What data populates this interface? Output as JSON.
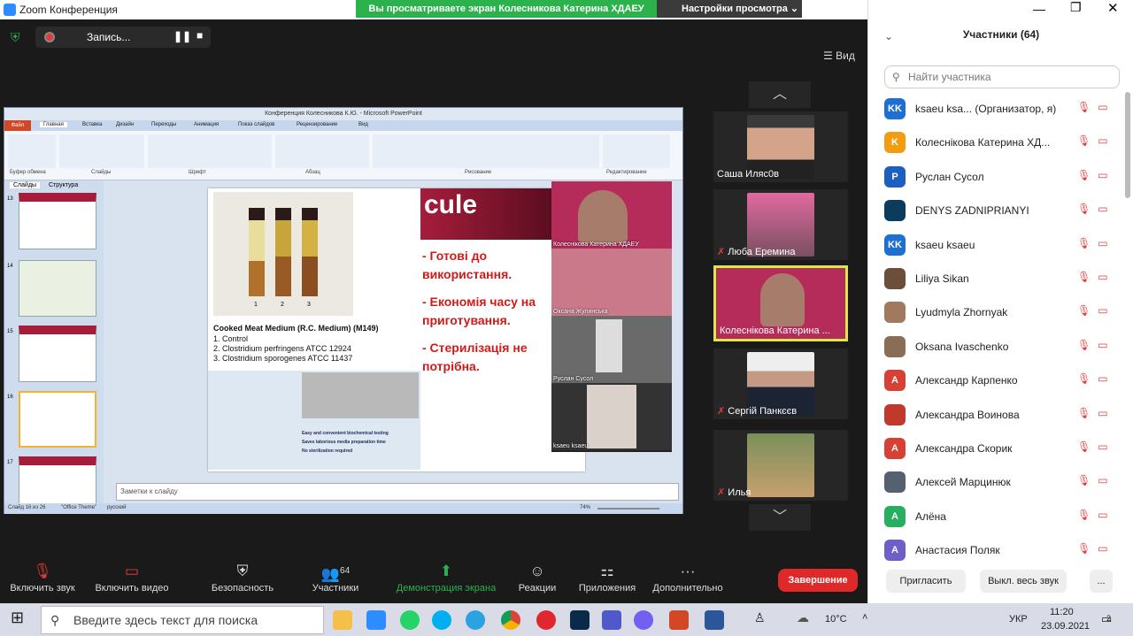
{
  "window": {
    "title": "Zoom Конференция",
    "banner": "Вы просматриваете экран Колесникова Катерина ХДАЕУ",
    "view_options": "Настройки просмотра",
    "view_button": "Вид"
  },
  "recording": {
    "label": "Запись..."
  },
  "ppt": {
    "title": "Конференция Колесникова К.Ю. - Microsoft PowerPoint",
    "tabs": [
      "Файл",
      "Главная",
      "Вставка",
      "Дизайн",
      "Переходы",
      "Анимация",
      "Показ слайдов",
      "Рецензирование",
      "Вид"
    ],
    "ribbon_groups": [
      "Буфер обмена",
      "Слайды",
      "Шрифт",
      "Абзац",
      "Рисование",
      "Редактирование"
    ],
    "panel_tabs": [
      "Слайды",
      "Структура"
    ],
    "thumb_numbers": [
      "13",
      "14",
      "15",
      "16",
      "17"
    ],
    "notes_placeholder": "Заметки к слайду",
    "status": {
      "slide": "Слайд 16 из 26",
      "theme": "\"Office Theme\"",
      "lang": "русский",
      "zoom": "74%"
    },
    "slide": {
      "brand_fragment": "cule",
      "caption_title": "Cooked Meat Medium (R.C. Medium) (M149)",
      "caption_items": [
        "1.  Control",
        "2.  Clostridium perfringens ATCC 12924",
        "3.  Clostridium sporogenes ATCC 11437"
      ],
      "tube_numbers": [
        "1",
        "2",
        "3"
      ],
      "bullets": [
        "- Готові до використання.",
        "- Економія часу на приготування.",
        "- Стерилізація не потрібна."
      ],
      "features": [
        "Easy and convenient biochemical testing",
        "Saves laborious media preparation time",
        "No sterilization required"
      ]
    },
    "cam_labels": [
      "Колеснікова Катерина ХДАЕУ",
      "Оксана Жулинська",
      "Руслан Сусол",
      "ksaeu ksaeu"
    ]
  },
  "gallery": [
    {
      "name": "Саша Иляс0в",
      "muted": false
    },
    {
      "name": "Люба Еремина",
      "muted": true
    },
    {
      "name": "Колеснікова Катерина ...",
      "muted": false
    },
    {
      "name": "Сергій Панкєєв",
      "muted": true
    },
    {
      "name": "Илья",
      "muted": true
    }
  ],
  "toolbar": [
    {
      "label": "Включить звук",
      "icon": "mic-muted-icon"
    },
    {
      "label": "Включить видео",
      "icon": "video-off-icon"
    },
    {
      "label": "Безопасность",
      "icon": "shield-icon"
    },
    {
      "label": "Участники",
      "icon": "participants-icon",
      "count": "64"
    },
    {
      "label": "Демонстрация экрана",
      "icon": "share-screen-icon"
    },
    {
      "label": "Реакции",
      "icon": "reactions-icon"
    },
    {
      "label": "Приложения",
      "icon": "apps-icon"
    },
    {
      "label": "Дополнительно",
      "icon": "more-icon"
    }
  ],
  "end_button": "Завершение",
  "participants": {
    "header": "Участники (64)",
    "search_placeholder": "Найти участника",
    "invite": "Пригласить",
    "mute_all": "Выкл. весь звук",
    "more": "...",
    "list": [
      {
        "name": "ksaeu ksa...  (Организатор, я)",
        "initials": "KK",
        "color": "#1d6fd1"
      },
      {
        "name": "Колеснікова Катерина ХД...",
        "initials": "K",
        "color": "#f39c12"
      },
      {
        "name": "Руслан Сусол",
        "initials": "P",
        "color": "#1d5fbf"
      },
      {
        "name": "DENYS ZADNIPRIANYI",
        "initials": "",
        "color": "#0b3c5d"
      },
      {
        "name": "ksaeu ksaeu",
        "initials": "KK",
        "color": "#1d6fd1"
      },
      {
        "name": "Liliya Sikan",
        "initials": "",
        "color": "#6b4f3a"
      },
      {
        "name": "Lyudmyla Zhornyak",
        "initials": "",
        "color": "#a07a5e"
      },
      {
        "name": "Oksana Ivaschenko",
        "initials": "",
        "color": "#8a6d55"
      },
      {
        "name": "Александр Карпенко",
        "initials": "A",
        "color": "#d64035"
      },
      {
        "name": "Александра Воинова",
        "initials": "",
        "color": "#c0392b"
      },
      {
        "name": "Александра Скорик",
        "initials": "A",
        "color": "#d64035"
      },
      {
        "name": "Алексей Марцинюк",
        "initials": "",
        "color": "#556070"
      },
      {
        "name": "Алёна",
        "initials": "A",
        "color": "#27ae60"
      },
      {
        "name": "Анастасия Поляк",
        "initials": "A",
        "color": "#6c5fc7"
      }
    ]
  },
  "taskbar": {
    "search_placeholder": "Введите здесь текст для поиска",
    "weather": "10°C",
    "lang": "УКР",
    "time": "11:20",
    "date": "23.09.2021",
    "notif": "2"
  }
}
